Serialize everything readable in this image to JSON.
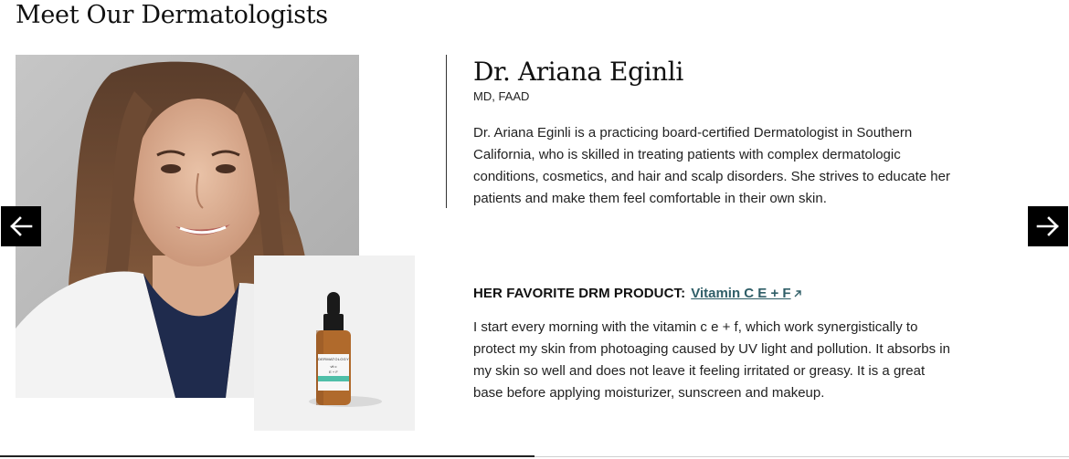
{
  "section": {
    "title": "Meet Our Dermatologists"
  },
  "doctor": {
    "name": "Dr. Ariana Eginli",
    "credentials": "MD, FAAD",
    "bio": "Dr. Ariana Eginli is a practicing board-certified Dermatologist in Southern California, who is skilled in treating patients with complex dermatologic conditions, cosmetics, and hair and scalp disorders. She strives to educate her patients and make them feel comfortable in their own skin."
  },
  "favorite": {
    "label": "HER FAVORITE DRM PRODUCT:",
    "product_name": "Vitamin C E + F",
    "quote": "I start every morning with the vitamin c e + f, which work synergistically to protect my skin from photoaging caused by UV light and pollution. It absorbs in my skin so well and does not leave it feeling irritated or greasy. It is a great base before applying moisturizer, sunscreen and makeup."
  },
  "product_label": {
    "brand": "DERMATOLOGY",
    "line1": "vit c",
    "line2": "E + F"
  },
  "carousel": {
    "prev_icon": "arrow-left-icon",
    "next_icon": "arrow-right-icon",
    "progress": 0.5
  },
  "colors": {
    "link": "#2f5e67",
    "arrow_bg": "#000000",
    "accent_band": "#4fbfa8"
  }
}
